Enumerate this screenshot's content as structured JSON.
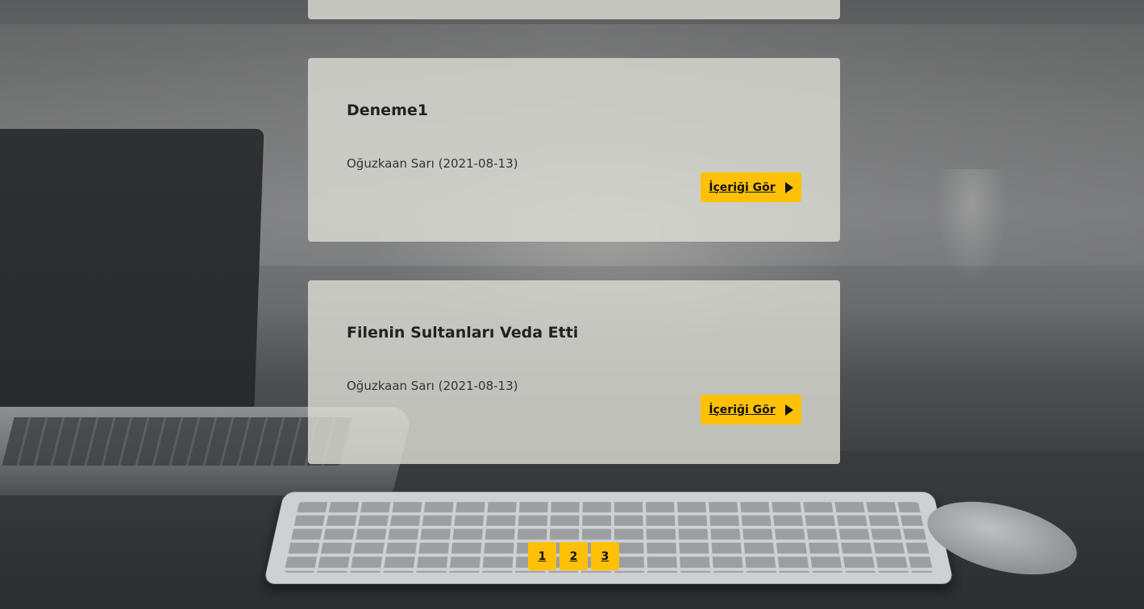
{
  "posts": [
    {
      "title": "Deneme1",
      "meta": "Oğuzkaan Sarı (2021-08-13)",
      "button_label": "İçeriği Gör"
    },
    {
      "title": "Filenin Sultanları Veda Etti",
      "meta": "Oğuzkaan Sarı (2021-08-13)",
      "button_label": "İçeriği Gör"
    }
  ],
  "pagination": {
    "pages": [
      "1",
      "2",
      "3"
    ]
  },
  "icons": {
    "button_icon": "play-triangle-icon"
  },
  "colors": {
    "accent": "#ffc107",
    "card_background": "#dcdcd4"
  }
}
